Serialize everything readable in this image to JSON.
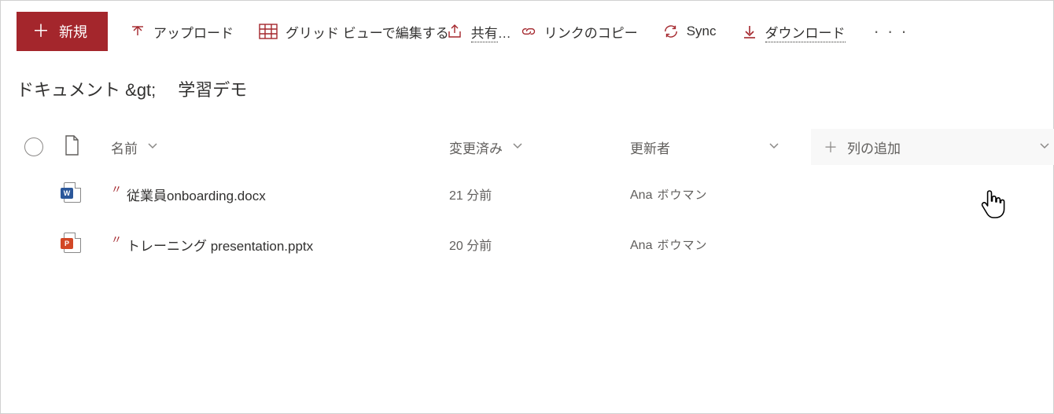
{
  "toolbar": {
    "new_label": "新規",
    "upload_label": "アップロード",
    "grid_edit_label": "グリッド ビューで編集する",
    "share_label": "共有",
    "copy_link_label": "リンクのコピー",
    "sync_label": "Sync",
    "download_label": "ダウンロード"
  },
  "breadcrumb": {
    "root": "ドキュメント",
    "sep": "&gt;",
    "current": "学習デモ"
  },
  "columns": {
    "name": "名前",
    "modified": "変更済み",
    "modified_by": "更新者",
    "add_column": "列の追加"
  },
  "files": [
    {
      "icon": "word",
      "badge": "W",
      "is_new": true,
      "name": "従業員onboarding.docx",
      "modified": "21 分前",
      "modified_by_first": "Ana",
      "modified_by_last": "ボウマン"
    },
    {
      "icon": "powerpoint",
      "badge": "P",
      "is_new": true,
      "name": "トレーニング presentation.pptx",
      "modified": "20 分前",
      "modified_by_first": "Ana",
      "modified_by_last": "ボウマン"
    }
  ]
}
